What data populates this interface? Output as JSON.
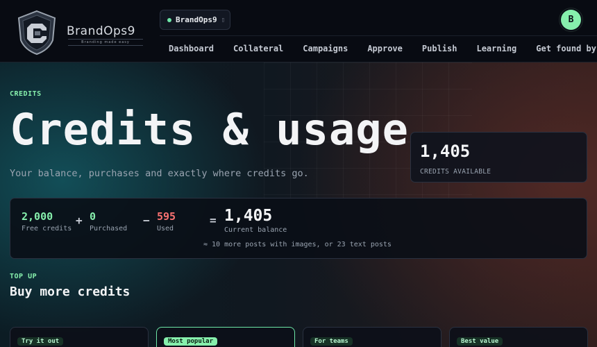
{
  "brand": {
    "name": "BrandOps9",
    "tagline": "Branding made easy"
  },
  "workspace": {
    "name": "BrandOps9",
    "caret_icon": "chevron-down-icon"
  },
  "user": {
    "avatar_initial": "B",
    "avatar_color": "#86efac"
  },
  "nav": {
    "items": [
      {
        "label": "Dashboard"
      },
      {
        "label": "Collateral"
      },
      {
        "label": "Campaigns"
      },
      {
        "label": "Approve"
      },
      {
        "label": "Publish"
      },
      {
        "label": "Learning"
      },
      {
        "label": "Get found by AI"
      }
    ]
  },
  "hero": {
    "eyebrow": "CREDITS",
    "title": "Credits & usage",
    "subtitle": "Your balance, purchases and exactly where credits go."
  },
  "available": {
    "value": "1,405",
    "label": "CREDITS AVAILABLE"
  },
  "balance": {
    "free": {
      "value": "2,000",
      "label": "Free credits"
    },
    "plus": "+",
    "purchased": {
      "value": "0",
      "label": "Purchased"
    },
    "minus": "−",
    "used": {
      "value": "595",
      "label": "Used"
    },
    "equals": "=",
    "current": {
      "value": "1,405",
      "label": "Current balance"
    },
    "estimate": "≈ 10 more posts with images, or 23 text posts"
  },
  "topup": {
    "eyebrow": "TOP UP",
    "title": "Buy more credits",
    "packs": [
      {
        "badge": "Try it out",
        "highlighted": false
      },
      {
        "badge": "Most popular",
        "highlighted": true
      },
      {
        "badge": "For teams",
        "highlighted": false
      },
      {
        "badge": "Best value",
        "highlighted": false
      }
    ]
  },
  "colors": {
    "accent": "#86efac",
    "used": "#f87171",
    "background": "#0b0f17"
  }
}
